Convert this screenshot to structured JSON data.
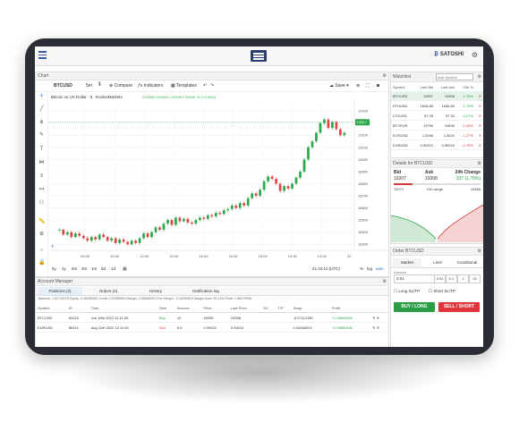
{
  "topbar": {
    "user": "SATOSHI"
  },
  "chart_panel": {
    "title": "Chart",
    "symbol": "BTCUSD",
    "interval": "5m",
    "compare": "Compare",
    "indicators": "Indicators",
    "templates": "Templates",
    "save": "Save",
    "legend": "Bitcoin vs US Dollar · 5 · EvolveMarkets",
    "ohlc": "O19300  H19303  L19298  C19302  +5 (+0.03%)",
    "last_price": "19307",
    "ranges": [
      "5y",
      "1y",
      "6m",
      "3m",
      "1m",
      "5d",
      "1d"
    ],
    "clock": "21:44:10 (UTC)",
    "pct": "%",
    "log": "log",
    "auto": "auto"
  },
  "chart_data": {
    "type": "candlestick",
    "x_ticks": [
      "09:00",
      "10:30",
      "12:00",
      "13:30",
      "15:00",
      "16:30",
      "18:00",
      "19:30",
      "21:00",
      "22"
    ],
    "y_ticks": [
      "19400",
      "19300",
      "19200",
      "19100",
      "19000",
      "18900",
      "18800",
      "18700",
      "18600",
      "18500",
      "18400",
      "18300"
    ],
    "y_range": [
      18250,
      19460
    ],
    "closes": [
      18420,
      18380,
      18400,
      18360,
      18390,
      18370,
      18350,
      18330,
      18360,
      18340,
      18380,
      18360,
      18330,
      18350,
      18310,
      18340,
      18320,
      18300,
      18330,
      18310,
      18350,
      18390,
      18360,
      18400,
      18440,
      18420,
      18470,
      18500,
      18460,
      18520,
      18490,
      18510,
      18480,
      18470,
      18500,
      18520,
      18510,
      18540,
      18530,
      18560,
      18550,
      18580,
      18590,
      18620,
      18600,
      18640,
      18620,
      18680,
      18720,
      18700,
      18750,
      18820,
      18860,
      18840,
      18800,
      18740,
      18780,
      18760,
      18800,
      18850,
      18900,
      19000,
      19100,
      19150,
      19220,
      19300,
      19330,
      19260,
      19310,
      19250,
      19200,
      19220
    ]
  },
  "watchlist": {
    "title": "Watchlist",
    "add_placeholder": "Add Symbol",
    "headers": [
      "Symbol",
      "Last Bid",
      "Last Ask",
      "24h %"
    ],
    "rows": [
      {
        "s": "BTCUSD",
        "b": "19307",
        "a": "19308",
        "c": "1.78%",
        "dir": "up"
      },
      {
        "s": "ETHUSD",
        "b": "1636.89",
        "a": "1636.89",
        "c": "1.79%",
        "dir": "up"
      },
      {
        "s": "LTCUSD",
        "b": "57.25",
        "a": "57.32",
        "c": "4.17%",
        "dir": "up"
      },
      {
        "s": "BTCEUR",
        "b": "19750",
        "a": "19630",
        "c": "-1.28%",
        "dir": "dn"
      },
      {
        "s": "EOSUSD",
        "b": "1.5396",
        "a": "1.5424",
        "c": "-1.27%",
        "dir": "dn"
      },
      {
        "s": "EURUSD",
        "b": "0.99221",
        "a": "0.99224",
        "c": "-0.76%",
        "dir": "dn"
      }
    ]
  },
  "details": {
    "title": "Details for BTCUSD",
    "bid_label": "Bid",
    "ask_label": "Ask",
    "change_label": "24h Change",
    "bid": "19307",
    "ask": "19308",
    "change": "337 (1.78%)",
    "low": "19271",
    "range_label": "24h range",
    "high": "19455"
  },
  "order": {
    "title": "Order BTCUSD",
    "tabs": [
      "Market",
      "Limit",
      "Conditional"
    ],
    "amount_label": "Amount",
    "amount": "0.01",
    "quick": [
      "0.01",
      "0.1",
      "1",
      "10"
    ],
    "long_sltp": "Long SL/TP",
    "short_sltp": "Short SL/TP",
    "buy": "BUY / LONG",
    "sell": "SELL / SHORT"
  },
  "account": {
    "title": "Account Manager",
    "tabs": [
      "Positions (2)",
      "Orders (2)",
      "History",
      "Notification log"
    ],
    "stats": "Balance: 1.61716175   Equity: 3.18056390   Credit: 0.00000000   Margin: 3.35545000   Free Margin: -0.16394610   Margin level: 93.12%   Profit: 1.66279056",
    "headers": [
      "Symbol",
      "ID",
      "Time",
      "Side",
      "Amount",
      "Price",
      "Last Price",
      "S/L",
      "T/P",
      "Swap",
      "Profit"
    ],
    "rows": [
      {
        "symbol": "BTCUSD",
        "id": "54123",
        "time": "Jun 18th 2022 12:11:00",
        "side": "Buy",
        "amount": "10",
        "price": "18255",
        "last": "19308",
        "sl": "",
        "tp": "",
        "swap": "-0.07114180",
        "profit": "+1.56800000"
      },
      {
        "symbol": "EURUSD",
        "id": "58124",
        "time": "Aug 11th 2022 12:11:00",
        "side": "Sell",
        "amount": "5.5",
        "price": "0.99224",
        "last": "0.99224",
        "sl": "",
        "tp": "",
        "swap": "0.00068229",
        "profit": "+1.09890032"
      }
    ]
  }
}
